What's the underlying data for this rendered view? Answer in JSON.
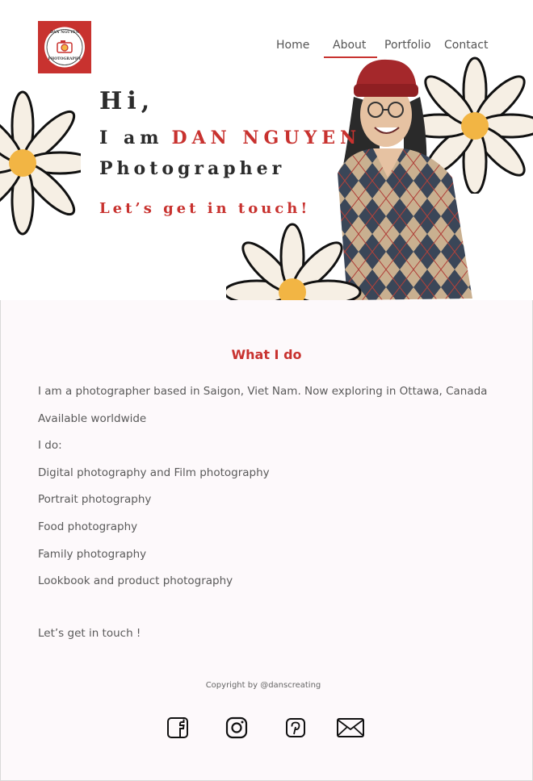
{
  "brand": {
    "logo_top_text": "DAN NGUYEN",
    "logo_bottom_text": "PHOTOGRAPHY"
  },
  "nav": {
    "items": [
      "Home",
      "About",
      "Portfolio",
      "Contact"
    ],
    "active": "About"
  },
  "hero": {
    "greeting": "Hi,",
    "intro": "I am",
    "name": "DAN NGUYEN",
    "role": "Photographer",
    "cta": "Let’s get in touch!"
  },
  "about": {
    "title": "What I do",
    "lines": [
      "I am a photographer based in Saigon, Viet Nam. Now exploring in Ottawa, Canada",
      "Available worldwide",
      "I do:",
      "Digital photography and Film photography",
      "Portrait photography",
      "Food photography",
      "Family photography",
      "Lookbook and product photography"
    ],
    "closing": "Let’s get in touch !"
  },
  "footer": {
    "copyright": "Copyright by @danscreating",
    "social_icons": [
      "facebook-icon",
      "instagram-icon",
      "pinterest-icon",
      "mail-icon"
    ]
  },
  "colors": {
    "accent": "#c8322f",
    "petal": "#f6efe4",
    "flower_center": "#f2b544",
    "page_bg": "#fdf9fb"
  }
}
